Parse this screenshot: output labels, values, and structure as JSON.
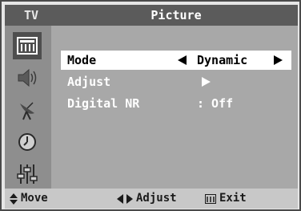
{
  "header": {
    "source_label": "TV",
    "title": "Picture"
  },
  "sidebar": {
    "icons": [
      {
        "name": "picture-icon",
        "active": true
      },
      {
        "name": "sound-icon",
        "active": false
      },
      {
        "name": "channel-icon",
        "active": false
      },
      {
        "name": "timer-icon",
        "active": false
      },
      {
        "name": "setup-icon",
        "active": false
      }
    ]
  },
  "menu": {
    "items": [
      {
        "label": "Mode",
        "value": "Dynamic"
      },
      {
        "label": "Adjust",
        "value": ""
      },
      {
        "label": "Digital NR",
        "value": ": Off"
      }
    ]
  },
  "footer": {
    "move_label": "Move",
    "adjust_label": "Adjust",
    "exit_label": "Exit"
  },
  "colors": {
    "header_bg": "#5b5b5b",
    "panel_bg": "#a8a8a8",
    "sidebar_bg": "#8e8e8e",
    "selected_bg": "#ffffff"
  }
}
